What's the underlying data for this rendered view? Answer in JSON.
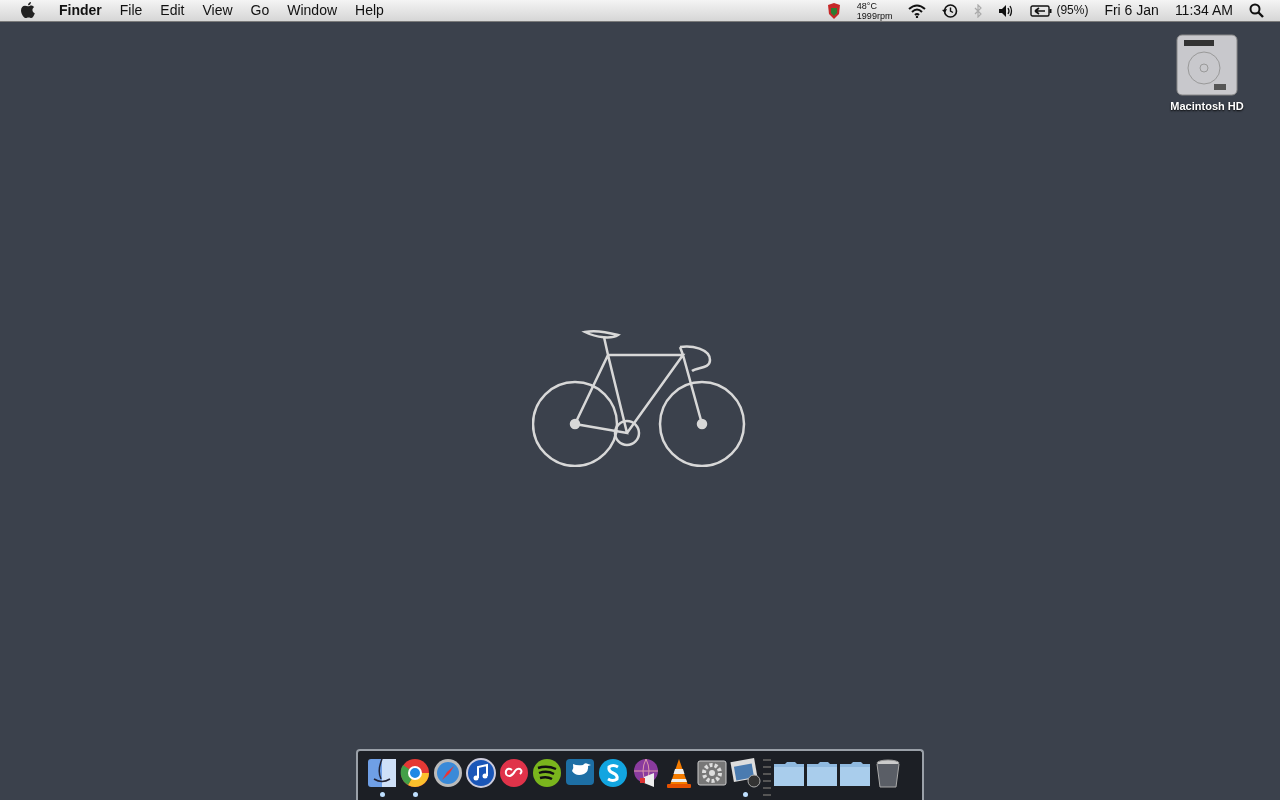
{
  "menu_bar": {
    "app_name": "Finder",
    "menus": [
      "File",
      "Edit",
      "View",
      "Go",
      "Window",
      "Help"
    ],
    "status": {
      "temperature": "48°C",
      "fan_speed": "1999rpm",
      "bluetooth": {
        "enabled": false
      },
      "battery": {
        "charging": true,
        "reading": "(95%)"
      },
      "date": "Fri 6 Jan",
      "time": "11:34 AM"
    }
  },
  "desktop": {
    "icons": [
      {
        "label": "Macintosh HD"
      }
    ]
  },
  "dock": {
    "items": [
      {
        "kind": "app",
        "running": true
      },
      {
        "kind": "app",
        "running": true
      },
      {
        "kind": "app",
        "running": false
      },
      {
        "kind": "app",
        "running": false
      },
      {
        "kind": "app",
        "running": false
      },
      {
        "kind": "app",
        "running": false
      },
      {
        "kind": "app",
        "running": false
      },
      {
        "kind": "app",
        "running": false
      },
      {
        "kind": "app",
        "running": false
      },
      {
        "kind": "app",
        "running": false
      },
      {
        "kind": "app",
        "running": false
      },
      {
        "kind": "app",
        "running": true
      },
      {
        "kind": "separator"
      },
      {
        "kind": "folder",
        "running": false
      },
      {
        "kind": "folder",
        "running": false
      },
      {
        "kind": "folder",
        "running": false
      },
      {
        "kind": "trash",
        "running": false
      }
    ]
  }
}
